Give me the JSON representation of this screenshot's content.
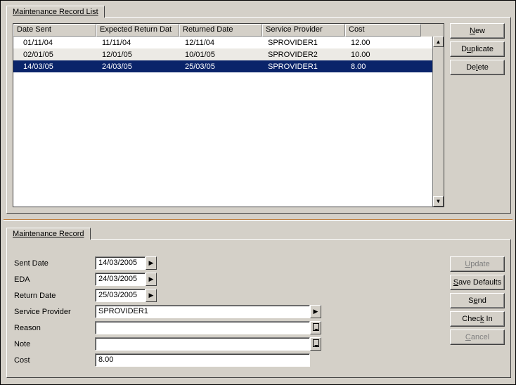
{
  "topTab": {
    "label": "Maintenance Record List"
  },
  "grid": {
    "headers": [
      "Date Sent",
      "Expected Return Dat",
      "Returned Date",
      "Service Provider",
      "Cost"
    ],
    "rows": [
      {
        "cells": [
          "01/11/04",
          "11/11/04",
          "12/11/04",
          "SPROVIDER1",
          "12.00"
        ],
        "alt": false,
        "selected": false
      },
      {
        "cells": [
          "02/01/05",
          "12/01/05",
          "10/01/05",
          "SPROVIDER2",
          "10.00"
        ],
        "alt": true,
        "selected": false
      },
      {
        "cells": [
          "14/03/05",
          "24/03/05",
          "25/03/05",
          "SPROVIDER1",
          "8.00"
        ],
        "alt": false,
        "selected": true
      }
    ]
  },
  "topButtons": {
    "new": {
      "pre": "",
      "u": "N",
      "post": "ew"
    },
    "duplicate": {
      "pre": "D",
      "u": "u",
      "post": "plicate"
    },
    "delete": {
      "pre": "De",
      "u": "l",
      "post": "ete"
    }
  },
  "bottomTab": {
    "label": "Maintenance Record"
  },
  "form": {
    "sentDate": {
      "label": "Sent Date",
      "value": "14/03/2005"
    },
    "eda": {
      "label": "EDA",
      "value": "24/03/2005"
    },
    "returnDate": {
      "label": "Return Date",
      "value": "25/03/2005"
    },
    "provider": {
      "label": "Service Provider",
      "value": "SPROVIDER1"
    },
    "reason": {
      "label": "Reason",
      "value": ""
    },
    "note": {
      "label": "Note",
      "value": ""
    },
    "cost": {
      "label": "Cost",
      "value": "8.00"
    }
  },
  "bottomButtons": {
    "update": {
      "pre": "",
      "u": "U",
      "post": "pdate",
      "disabled": true
    },
    "saveDefaults": {
      "pre": "",
      "u": "S",
      "post": "ave Defaults",
      "disabled": false
    },
    "send": {
      "pre": "S",
      "u": "e",
      "post": "nd",
      "disabled": false
    },
    "checkIn": {
      "pre": "Chec",
      "u": "k",
      "post": " In",
      "disabled": false
    },
    "cancel": {
      "pre": "",
      "u": "C",
      "post": "ancel",
      "disabled": true
    }
  }
}
